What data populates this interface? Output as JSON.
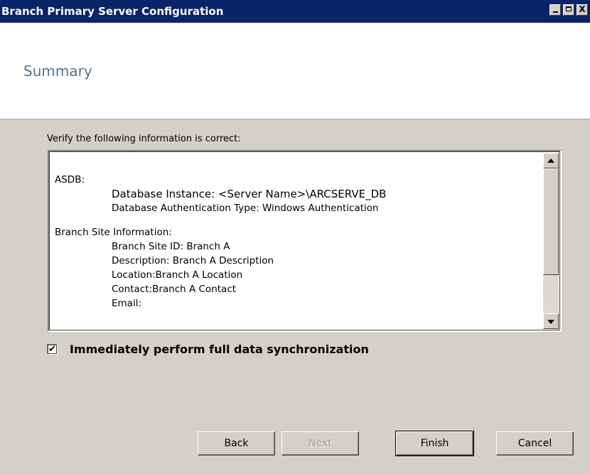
{
  "window": {
    "title": "Branch Primary Server Configuration",
    "controls": {
      "minimize_icon": "minimize-icon",
      "maximize_icon": "maximize-icon",
      "close_icon": "close-icon",
      "close_glyph": "X"
    }
  },
  "header": {
    "title": "Summary"
  },
  "body": {
    "prompt": "Verify the following information is correct:",
    "summary": {
      "asdb_label": "ASDB:",
      "db_instance": "Database Instance: <Server Name>\\ARCSERVE_DB",
      "db_auth": "Database Authentication Type: Windows Authentication",
      "branch_label": "Branch Site Information:",
      "site_id": "Branch Site ID: Branch A",
      "description": "Description: Branch A Description",
      "location": "Location:Branch A Location",
      "contact": "Contact:Branch A Contact",
      "email": "Email:"
    }
  },
  "sync_option": {
    "label": "Immediately perform full data synchronization",
    "checked": true,
    "mark": "✔"
  },
  "buttons": {
    "back": "Back",
    "next": "Next",
    "finish": "Finish",
    "cancel": "Cancel",
    "next_enabled": false
  },
  "colors": {
    "titlebar": "#0a246a",
    "heading": "#5c6e9a",
    "face": "#d4d0c8"
  }
}
